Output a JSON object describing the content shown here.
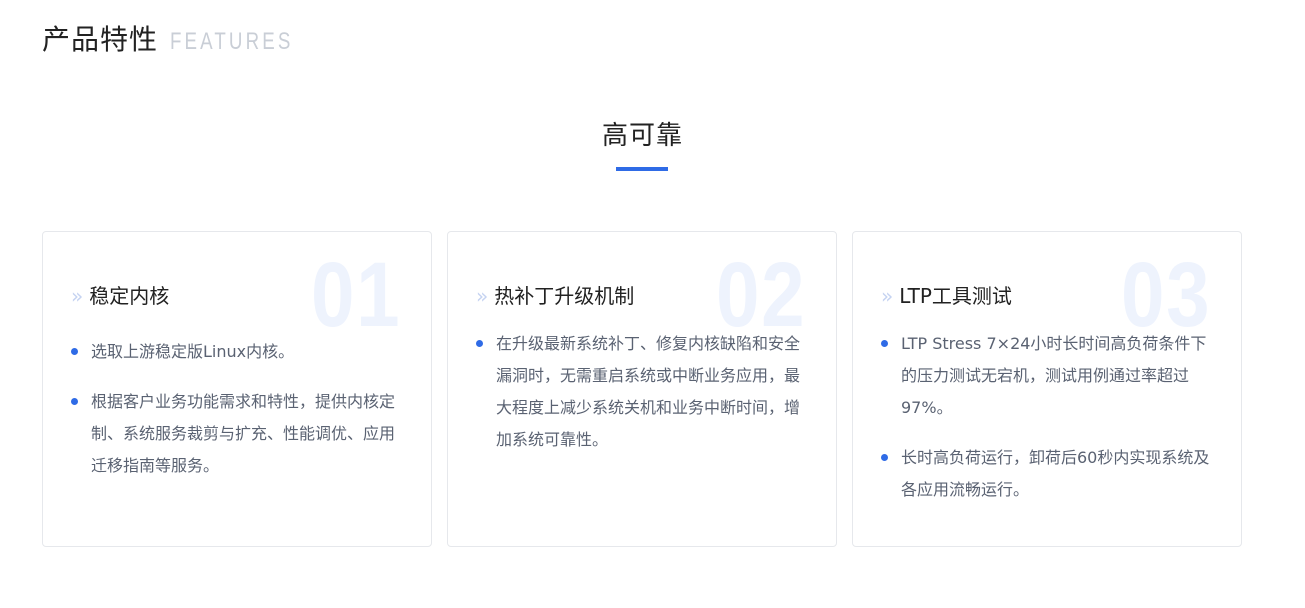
{
  "header": {
    "title": "产品特性",
    "subtitle": "FEATURES"
  },
  "section": {
    "title": "高可靠"
  },
  "cards": [
    {
      "number": "01",
      "title": "稳定内核",
      "bullets": [
        "选取上游稳定版Linux内核。",
        "根据客户业务功能需求和特性，提供内核定制、系统服务裁剪与扩充、性能调优、应用迁移指南等服务。"
      ]
    },
    {
      "number": "02",
      "title": "热补丁升级机制",
      "bullets": [
        "在升级最新系统补丁、修复内核缺陷和安全漏洞时，无需重启系统或中断业务应用，最大程度上减少系统关机和业务中断时间，增加系统可靠性。"
      ]
    },
    {
      "number": "03",
      "title": "LTP工具测试",
      "bullets": [
        "LTP Stress 7×24小时长时间高负荷条件下的压力测试无宕机，测试用例通过率超过97%。",
        "长时高负荷运行，卸荷后60秒内实现系统及各应用流畅运行。"
      ]
    }
  ],
  "icons": {
    "title_prefix": "chevron-double-right-icon",
    "bullet": "dot-icon"
  },
  "colors": {
    "accent": "#2f6be6",
    "number_watermark": "#eef3fd",
    "border": "#e6e8ec"
  }
}
